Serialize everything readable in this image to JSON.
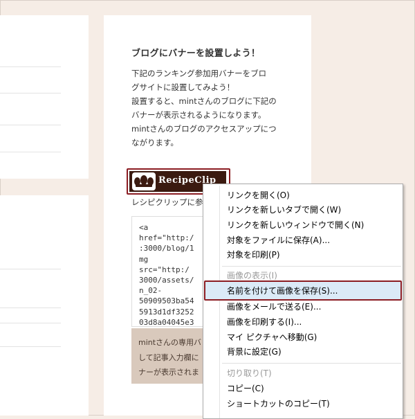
{
  "main": {
    "heading": "ブログにバナーを設置しよう！",
    "description_lines": [
      "下記のランキング参加用バナーをブロ",
      "グサイトに設置してみよう！",
      "設置すると、mintさんのブログに下記の",
      "バナーが表示されるようになります。",
      "mintさんのブログのアクセスアップにつ",
      "ながります。"
    ],
    "banner_text": "RecipeClip",
    "caption": "レシピクリップに参加",
    "code_lines": [
      "<a",
      "href=\"http:/",
      ":3000/blog/1",
      "mg",
      "src=\"http:/",
      "3000/assets/",
      "n_02-",
      "50909503ba54",
      "5913d1df3252",
      "03d8a04045e3"
    ],
    "note_lines": [
      "mintさんの専用バ",
      "して記事入力欄に",
      "ナーが表示されま"
    ]
  },
  "context_menu": {
    "items": [
      {
        "label": "リンクを開く(O)",
        "disabled": false
      },
      {
        "label": "リンクを新しいタブで開く(W)",
        "disabled": false
      },
      {
        "label": "リンクを新しいウィンドウで開く(N)",
        "disabled": false
      },
      {
        "label": "対象をファイルに保存(A)...",
        "disabled": false
      },
      {
        "label": "対象を印刷(P)",
        "disabled": false
      },
      {
        "label": "画像の表示(I)",
        "disabled": true
      },
      {
        "label": "名前を付けて画像を保存(S)...",
        "disabled": false,
        "highlighted": true
      },
      {
        "label": "画像をメールで送る(E)...",
        "disabled": false
      },
      {
        "label": "画像を印刷する(I)...",
        "disabled": false
      },
      {
        "label": "マイ ピクチャへ移動(G)",
        "disabled": false
      },
      {
        "label": "背景に設定(G)",
        "disabled": false
      },
      {
        "label": "切り取り(T)",
        "disabled": true
      },
      {
        "label": "コピー(C)",
        "disabled": false
      },
      {
        "label": "ショートカットのコピー(T)",
        "disabled": false
      }
    ]
  },
  "colors": {
    "page_background": "#f6ede6",
    "highlight_border": "#8b1c22",
    "banner_background": "#3b1a10",
    "note_background": "#d9c9bc"
  }
}
